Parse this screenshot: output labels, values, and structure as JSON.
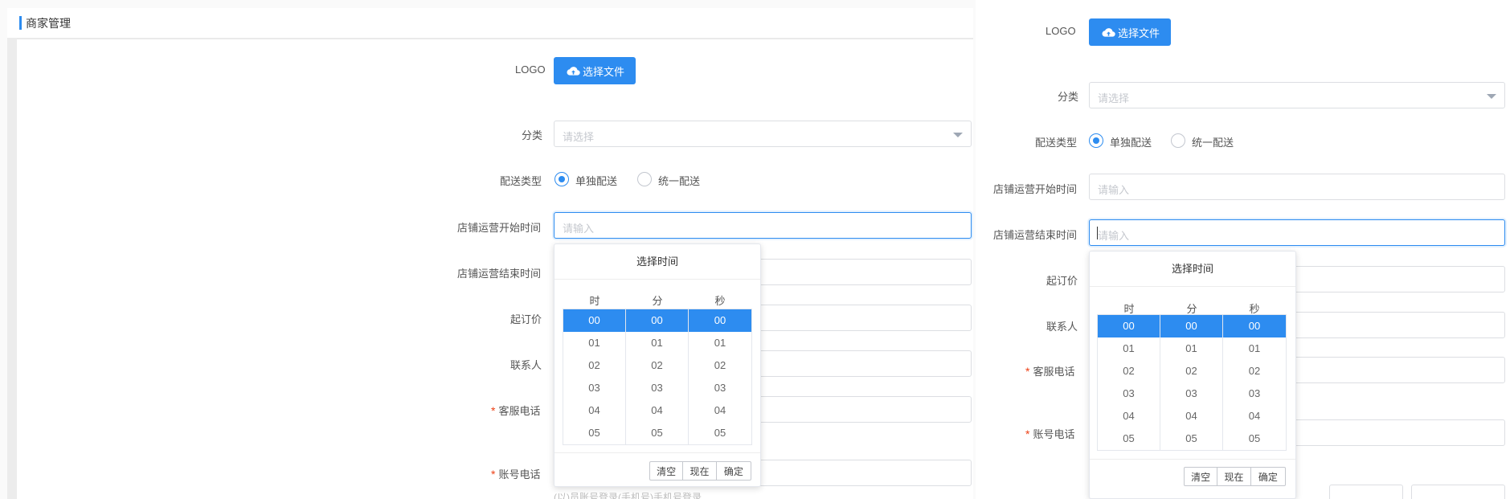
{
  "header": {
    "title": "商家管理"
  },
  "form": {
    "logo_label": "LOGO",
    "upload_button": "选择文件",
    "category_label": "分类",
    "category_placeholder": "请选择",
    "delivery_label": "配送类型",
    "delivery_options": [
      "单独配送",
      "统一配送"
    ],
    "delivery_selected": "单独配送",
    "start_time_label": "店铺运营开始时间",
    "start_time_placeholder": "请输入",
    "end_time_label": "店铺运营结束时间",
    "end_time_placeholder": "请输入",
    "min_order_label": "起订价",
    "contact_label": "联系人",
    "service_phone_label": "客服电话",
    "account_phone_label": "账号电话",
    "truncated_hint": "(以)员账号登录(手机号)手机号登录"
  },
  "time_picker": {
    "title": "选择时间",
    "columns": [
      "时",
      "分",
      "秒"
    ],
    "values": [
      "00",
      "01",
      "02",
      "03",
      "04",
      "05"
    ],
    "selected": "00",
    "buttons": {
      "clear": "清空",
      "now": "现在",
      "confirm": "确定"
    }
  },
  "colors": {
    "primary": "#2d8cf0",
    "required": "#ed3f14",
    "border": "#dcdee2",
    "placeholder": "#c5c8ce"
  },
  "icons": {
    "upload": "cloud-upload-icon"
  }
}
